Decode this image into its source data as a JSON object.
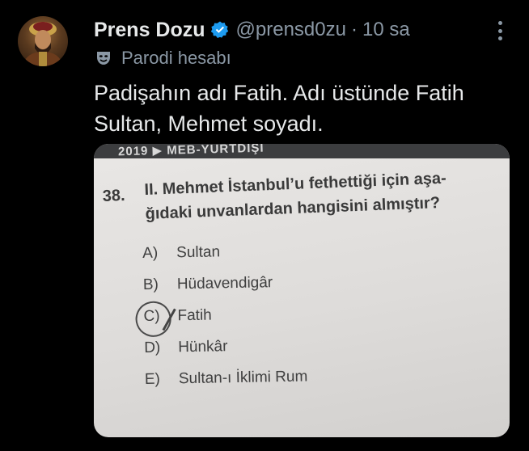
{
  "tweet": {
    "author_name": "Prens Dozu",
    "handle": "@prensd0zu",
    "separator": "·",
    "time": "10 sa",
    "parody_label": "Parodi hesabı",
    "text_lines": [
      "Padişahın adı Fatih. Adı üstünde Fatih",
      "Sultan, Mehmet soyadı."
    ]
  },
  "icons": {
    "verified": "verified-badge-icon",
    "parody": "theater-mask-icon",
    "more": "more-options-icon",
    "verified_color": "#1d9bf0"
  },
  "exam": {
    "header_strip": "2019 ▶ MEB-YURTDIŞI",
    "question_number": "38.",
    "question_lines": [
      "II. Mehmet İstanbul’u fethettiği için aşa-",
      "ğıdaki unvanlardan hangisini almıştır?"
    ],
    "options": [
      {
        "label": "A)",
        "text": "Sultan"
      },
      {
        "label": "B)",
        "text": "Hüdavendigâr"
      },
      {
        "label": "C)",
        "text": "Fatih"
      },
      {
        "label": "D)",
        "text": "Hünkâr"
      },
      {
        "label": "E)",
        "text": "Sultan-ı İklimi Rum"
      }
    ],
    "circled_option": "C)"
  }
}
